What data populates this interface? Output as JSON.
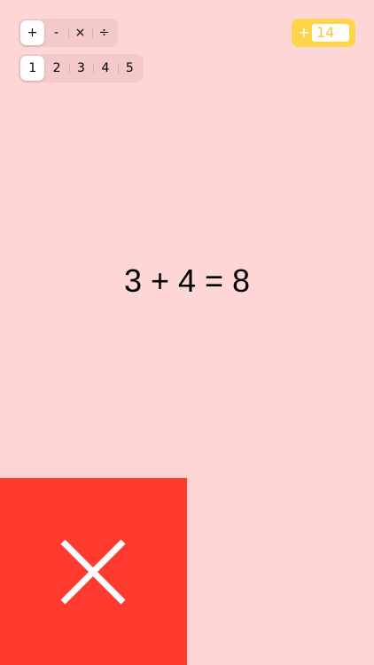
{
  "operations": {
    "items": [
      "+",
      "-",
      "×",
      "÷"
    ],
    "selected": "+"
  },
  "levels": {
    "items": [
      "1",
      "2",
      "3",
      "4",
      "5"
    ],
    "selected": "1"
  },
  "score": {
    "prefix": "+",
    "value": "14"
  },
  "equation": {
    "text": "3 + 4 = 8"
  },
  "feedback": {
    "state": "wrong",
    "icon": "close-icon",
    "panel_color": "#ff3b30"
  },
  "colors": {
    "background": "#ffd6d6",
    "score_badge": "#fdd54a"
  }
}
